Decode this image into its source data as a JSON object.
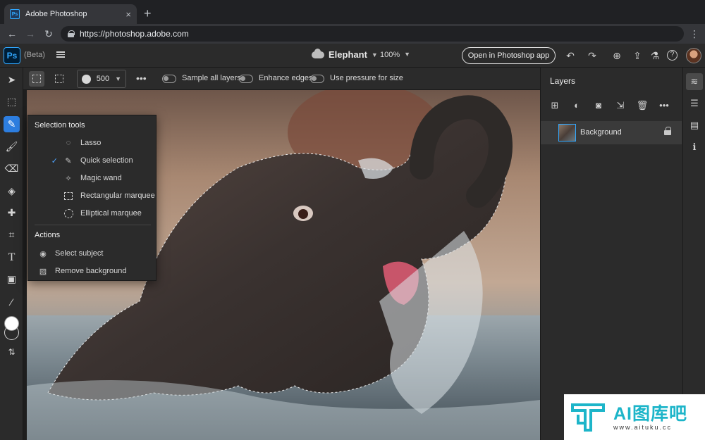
{
  "browser": {
    "tab_title": "Adobe Photoshop",
    "tab_favicon": "Ps",
    "new_tab": "+",
    "close_tab": "×",
    "url": "https://photoshop.adobe.com",
    "nav": {
      "back": "←",
      "forward": "→",
      "reload": "↻",
      "menu": "⋮"
    }
  },
  "app": {
    "logo": "Ps",
    "beta": "(Beta)",
    "doc_name": "Elephant",
    "zoom": "100%",
    "open_button": "Open in Photoshop app",
    "icons": [
      "undo-icon",
      "redo-icon",
      "user-share-icon",
      "export-icon",
      "flask-icon",
      "help-icon"
    ],
    "icon_glyphs": {
      "undo": "↶",
      "redo": "↷",
      "share": "⊕",
      "export": "⇪",
      "flask": "⚗",
      "help": "?"
    },
    "accent_color": "#31a8ff"
  },
  "toolbar": {
    "tools": [
      {
        "name": "move-tool",
        "glyph": "➤"
      },
      {
        "name": "transform-tool",
        "glyph": "⬚"
      },
      {
        "name": "quick-selection-tool",
        "glyph": "✎",
        "active": true
      },
      {
        "name": "brush-tool",
        "glyph": "🖌"
      },
      {
        "name": "eraser-tool",
        "glyph": "⌫"
      },
      {
        "name": "paint-bucket-tool",
        "glyph": "◈"
      },
      {
        "name": "healing-tool",
        "glyph": "✚"
      },
      {
        "name": "crop-tool",
        "glyph": "⌗"
      },
      {
        "name": "type-tool",
        "glyph": "T"
      },
      {
        "name": "place-image-tool",
        "glyph": "▣"
      },
      {
        "name": "eyedropper-tool",
        "glyph": "⁄"
      }
    ],
    "swap_glyph": "⇅",
    "foreground_color": "#ffffff"
  },
  "options": {
    "brush_size": "500",
    "more": "•••",
    "sample_all_layers": "Sample all layers",
    "enhance_edges": "Enhance edges",
    "use_pressure": "Use pressure for size"
  },
  "flyout": {
    "section1": "Selection tools",
    "items1": [
      {
        "label": "Lasso",
        "checked": false,
        "icon": "lasso-icon"
      },
      {
        "label": "Quick selection",
        "checked": true,
        "icon": "quick-selection-icon"
      },
      {
        "label": "Magic wand",
        "checked": false,
        "icon": "magic-wand-icon"
      },
      {
        "label": "Rectangular marquee",
        "checked": false,
        "icon": "rect-marquee-icon"
      },
      {
        "label": "Elliptical marquee",
        "checked": false,
        "icon": "ellipse-marquee-icon"
      }
    ],
    "check_glyph": "✓",
    "section2": "Actions",
    "items2": [
      {
        "label": "Select subject",
        "icon": "select-subject-icon"
      },
      {
        "label": "Remove background",
        "icon": "remove-background-icon"
      }
    ]
  },
  "layers": {
    "title": "Layers",
    "icons": {
      "add": "⊞",
      "adjust": "◐",
      "mask": "◙",
      "import": "⇲",
      "delete": "🗑",
      "more": "•••"
    },
    "rows": [
      {
        "name": "Background",
        "locked": true
      }
    ]
  },
  "rail": {
    "icons": {
      "layers": "≋",
      "properties": "☰",
      "comments": "▤",
      "info": "ℹ"
    }
  },
  "watermark": {
    "main": "AI图库吧",
    "sub": "www.aituku.cc"
  }
}
